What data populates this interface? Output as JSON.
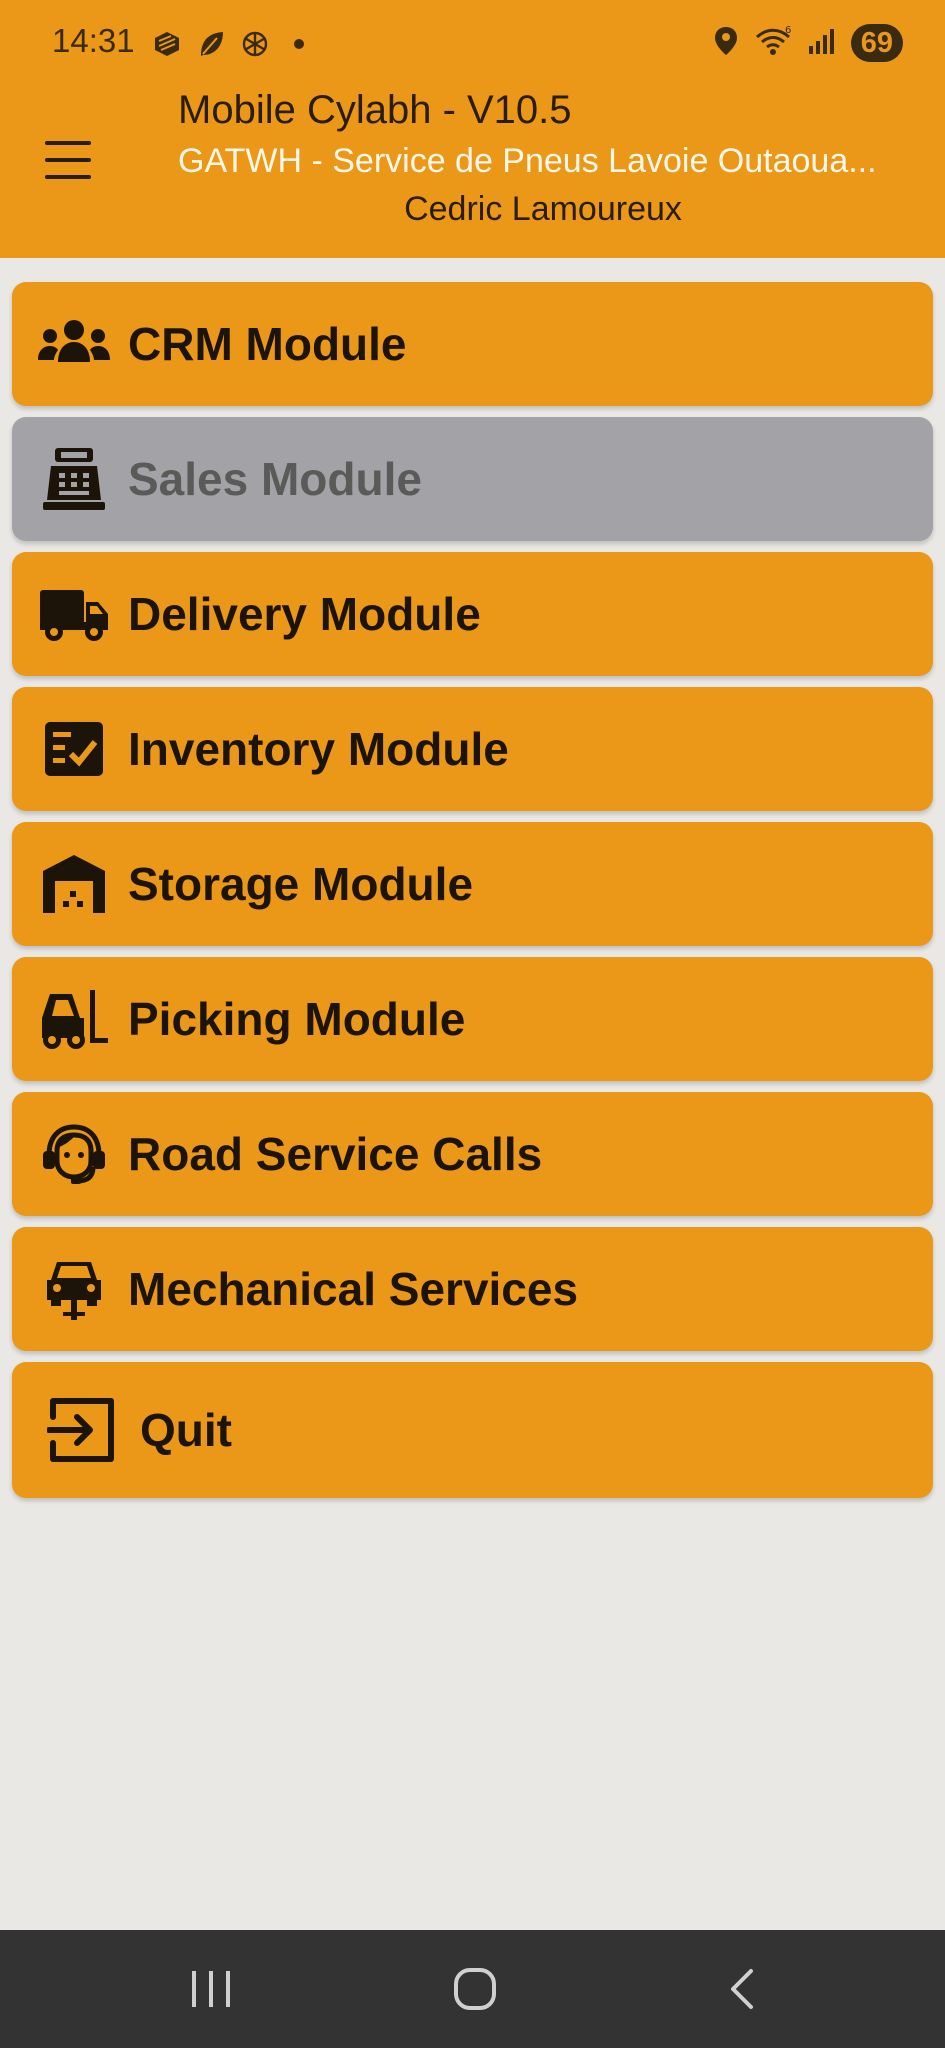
{
  "status_bar": {
    "time": "14:31",
    "battery": "69",
    "left_icons": [
      "app-icon",
      "leaf-icon",
      "openai-icon",
      "dot-icon"
    ],
    "right_icons": [
      "location-icon",
      "wifi-icon",
      "signal-icon"
    ]
  },
  "header": {
    "title": "Mobile Cylabh - V10.5",
    "subtitle": "GATWH - Service de Pneus Lavoie Outaoua...",
    "user": "Cedric Lamoureux",
    "background": "#eb9717"
  },
  "menu": {
    "items": [
      {
        "label": "CRM Module",
        "icon": "people-icon",
        "enabled": true
      },
      {
        "label": "Sales Module",
        "icon": "cash-register-icon",
        "enabled": false
      },
      {
        "label": "Delivery Module",
        "icon": "truck-icon",
        "enabled": true
      },
      {
        "label": "Inventory Module",
        "icon": "checklist-icon",
        "enabled": true
      },
      {
        "label": "Storage Module",
        "icon": "warehouse-icon",
        "enabled": true
      },
      {
        "label": "Picking Module",
        "icon": "forklift-icon",
        "enabled": true
      },
      {
        "label": "Road Service Calls",
        "icon": "headset-agent-icon",
        "enabled": true
      },
      {
        "label": "Mechanical Services",
        "icon": "car-lift-icon",
        "enabled": true
      },
      {
        "label": "Quit",
        "icon": "exit-icon",
        "enabled": true
      }
    ],
    "colors": {
      "enabled": "#eb9717",
      "disabled": "#a3a2a7"
    }
  },
  "nav_bar": {
    "buttons": [
      "recents-icon",
      "home-icon",
      "back-icon"
    ]
  }
}
